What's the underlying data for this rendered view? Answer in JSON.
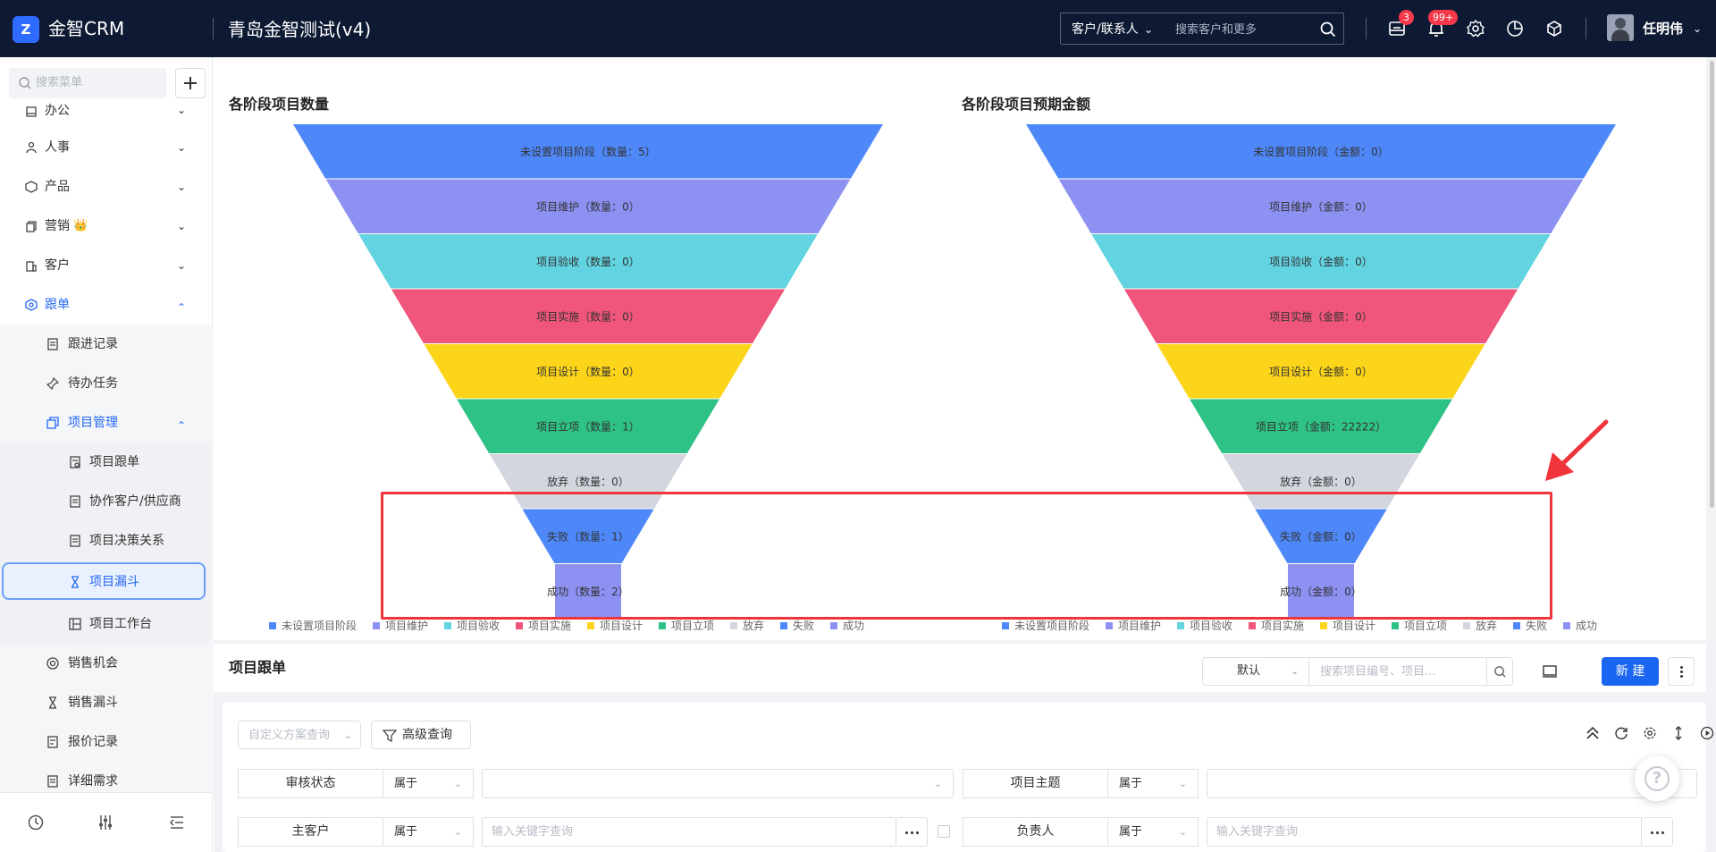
{
  "topbar": {
    "brand": "金智CRM",
    "logo_glyph": "Z",
    "company": "青岛金智测试(v4)",
    "search_scope": "客户/联系人",
    "search_placeholder": "搜索客户和更多",
    "badges": {
      "messages": "3",
      "notifications": "99+"
    },
    "user_name": "任明伟",
    "icons": [
      "message-icon",
      "bell-icon",
      "gear-icon",
      "pie-chart-icon",
      "cube-icon"
    ]
  },
  "sidebar": {
    "search_placeholder": "搜索菜单",
    "items": [
      {
        "label": "办公",
        "icon": "office-icon"
      },
      {
        "label": "人事",
        "icon": "people-icon"
      },
      {
        "label": "产品",
        "icon": "product-icon"
      },
      {
        "label": "营销",
        "icon": "marketing-icon",
        "crown": "👑"
      },
      {
        "label": "客户",
        "icon": "customer-icon"
      },
      {
        "label": "跟单",
        "icon": "follow-icon"
      },
      {
        "label": "跟进记录",
        "icon": "record-icon"
      },
      {
        "label": "待办任务",
        "icon": "pin-icon"
      },
      {
        "label": "项目管理",
        "icon": "project-icon"
      },
      {
        "label": "项目跟单",
        "icon": "doc-icon"
      },
      {
        "label": "协作客户/供应商",
        "icon": "list-icon"
      },
      {
        "label": "项目决策关系",
        "icon": "list-icon"
      },
      {
        "label": "项目漏斗",
        "icon": "hourglass-icon"
      },
      {
        "label": "项目工作台",
        "icon": "board-icon"
      },
      {
        "label": "销售机会",
        "icon": "target-icon"
      },
      {
        "label": "销售漏斗",
        "icon": "hourglass-icon"
      },
      {
        "label": "报价记录",
        "icon": "quote-icon"
      },
      {
        "label": "详细需求",
        "icon": "doc-icon"
      }
    ]
  },
  "charts": {
    "left_title": "各阶段项目数量",
    "right_title": "各阶段项目预期金额",
    "legend": [
      "未设置项目阶段",
      "项目维护",
      "项目验收",
      "项目实施",
      "项目设计",
      "项目立项",
      "放弃",
      "失败",
      "成功"
    ],
    "colors": [
      "#4e88f8",
      "#8c91f2",
      "#62d3e0",
      "#f0567b",
      "#fcd41a",
      "#2ec286",
      "#d3d6de",
      "#4e88f8",
      "#8c91f2"
    ]
  },
  "chart_data": [
    {
      "type": "funnel",
      "title": "各阶段项目数量",
      "categories": [
        "未设置项目阶段",
        "项目维护",
        "项目验收",
        "项目实施",
        "项目设计",
        "项目立项",
        "放弃",
        "失败",
        "成功"
      ],
      "labels": [
        "未设置项目阶段（数量：5）",
        "项目维护（数量：0）",
        "项目验收（数量：0）",
        "项目实施（数量：0）",
        "项目设计（数量：0）",
        "项目立项（数量：1）",
        "放弃（数量：0）",
        "失败（数量：1）",
        "成功（数量：2）"
      ],
      "values": [
        5,
        0,
        0,
        0,
        0,
        1,
        0,
        1,
        2
      ]
    },
    {
      "type": "funnel",
      "title": "各阶段项目预期金额",
      "categories": [
        "未设置项目阶段",
        "项目维护",
        "项目验收",
        "项目实施",
        "项目设计",
        "项目立项",
        "放弃",
        "失败",
        "成功"
      ],
      "labels": [
        "未设置项目阶段（金额：0）",
        "项目维护（金额：0）",
        "项目验收（金额：0）",
        "项目实施（金额：0）",
        "项目设计（金额：0）",
        "项目立项（金额：22222）",
        "放弃（金额：0）",
        "失败（金额：0）",
        "成功（金额：0）"
      ],
      "values": [
        0,
        0,
        0,
        0,
        0,
        22222,
        0,
        0,
        0
      ]
    }
  ],
  "list": {
    "title": "项目跟单",
    "view": "默认",
    "search_placeholder": "搜索项目编号、项目...",
    "new_label": "新 建"
  },
  "filters": {
    "scheme_placeholder": "自定义方案查询",
    "advanced_label": "高级查询",
    "rows": [
      {
        "label": "审核状态",
        "op": "属于",
        "value": ""
      },
      {
        "label": "项目主题",
        "op": "属于",
        "value": ""
      },
      {
        "label": "主客户",
        "op": "属于",
        "placeholder": "输入关键字查询"
      },
      {
        "label": "负责人",
        "op": "属于",
        "placeholder": "输入关键字查询"
      }
    ]
  },
  "help_glyph": "?"
}
